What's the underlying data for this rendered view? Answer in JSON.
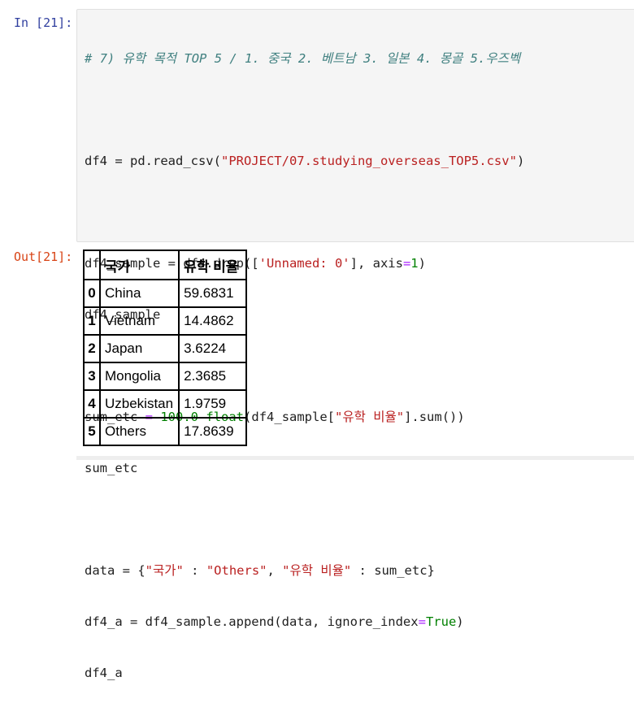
{
  "in_prompt": "In [21]:",
  "out_prompt": "Out[21]:",
  "code": {
    "l1": "# 7) 유학 목적 TOP 5 / 1. 중국 2. 베트남 3. 일본 4. 몽골 5.우즈벡",
    "l3a": "df4 = pd.read_csv(",
    "l3b": "\"PROJECT/07.studying_overseas_TOP5.csv\"",
    "l3c": ")",
    "l5a": "df4_sample = df4.drop([",
    "l5b": "'Unnamed: 0'",
    "l5c": "], axis",
    "l5d": "=",
    "l5e": "1",
    "l5f": ")",
    "l6": "df4_sample",
    "l8a": "sum_etc ",
    "l8b": "=",
    "l8c": " ",
    "l8d": "100.0",
    "l8e": "-",
    "l8f": "float",
    "l8g": "(df4_sample[",
    "l8h": "\"유학 비율\"",
    "l8i": "].sum())",
    "l9": "sum_etc",
    "l11a": "data = {",
    "l11b": "\"국가\"",
    "l11c": " : ",
    "l11d": "\"Others\"",
    "l11e": ", ",
    "l11f": "\"유학 비율\"",
    "l11g": " : sum_etc}",
    "l12a": "df4_a = df4_sample.append(data, ignore_index",
    "l12b": "=",
    "l12c": "True",
    "l12d": ")",
    "l13": "df4_a"
  },
  "table": {
    "headers": [
      "국가",
      "유학 비율"
    ],
    "rows": [
      {
        "index": "0",
        "country": "China",
        "ratio": "59.6831"
      },
      {
        "index": "1",
        "country": "Vietnam",
        "ratio": "14.4862"
      },
      {
        "index": "2",
        "country": "Japan",
        "ratio": "3.6224"
      },
      {
        "index": "3",
        "country": "Mongolia",
        "ratio": "2.3685"
      },
      {
        "index": "4",
        "country": "Uzbekistan",
        "ratio": "1.9759"
      },
      {
        "index": "5",
        "country": "Others",
        "ratio": "17.8639"
      }
    ]
  }
}
